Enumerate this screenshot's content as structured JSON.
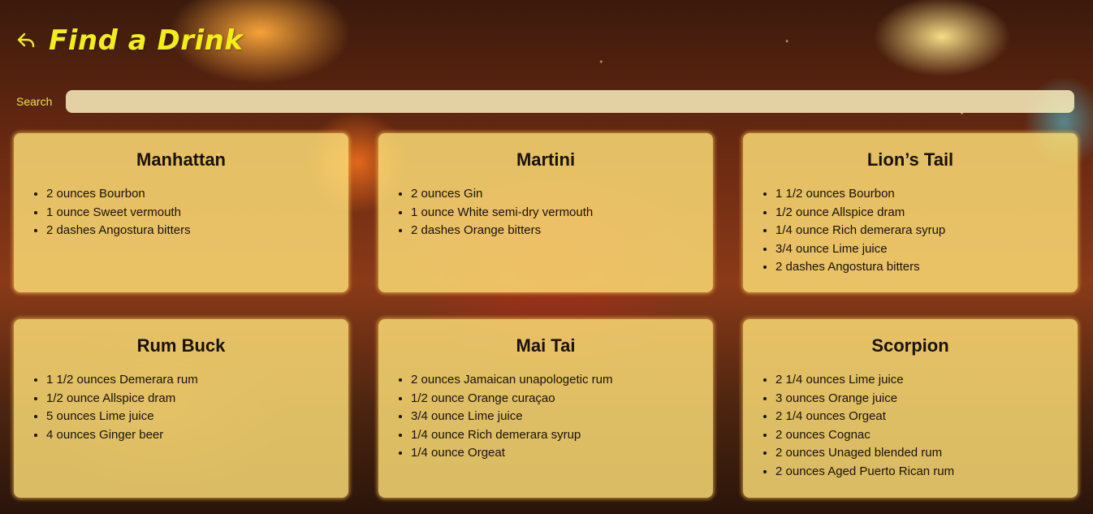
{
  "header": {
    "back_icon": "back-arrow-icon",
    "title": "Find a Drink"
  },
  "search": {
    "label": "Search",
    "value": "",
    "placeholder": ""
  },
  "colors": {
    "title": "#f3ee18",
    "card_background": "#ffe178",
    "card_text": "#1a1208"
  },
  "drinks": [
    {
      "name": "Manhattan",
      "ingredients": [
        "2 ounces Bourbon",
        "1 ounce Sweet vermouth",
        "2 dashes Angostura bitters"
      ]
    },
    {
      "name": "Martini",
      "ingredients": [
        "2 ounces Gin",
        "1 ounce White semi-dry vermouth",
        "2 dashes Orange bitters"
      ]
    },
    {
      "name": "Lion’s Tail",
      "ingredients": [
        "1 1/2 ounces Bourbon",
        "1/2 ounce Allspice dram",
        "1/4 ounce Rich demerara syrup",
        "3/4 ounce Lime juice",
        "2 dashes Angostura bitters"
      ]
    },
    {
      "name": "Rum Buck",
      "ingredients": [
        "1 1/2 ounces Demerara rum",
        "1/2 ounce Allspice dram",
        "5 ounces Lime juice",
        "4 ounces Ginger beer"
      ]
    },
    {
      "name": "Mai Tai",
      "ingredients": [
        "2 ounces Jamaican unapologetic rum",
        "1/2 ounce Orange curaçao",
        "3/4 ounce Lime juice",
        "1/4 ounce Rich demerara syrup",
        "1/4 ounce Orgeat"
      ]
    },
    {
      "name": "Scorpion",
      "ingredients": [
        "2 1/4 ounces Lime juice",
        "3 ounces Orange juice",
        "2 1/4 ounces Orgeat",
        "2 ounces Cognac",
        "2 ounces Unaged blended rum",
        "2 ounces Aged Puerto Rican rum"
      ]
    }
  ]
}
